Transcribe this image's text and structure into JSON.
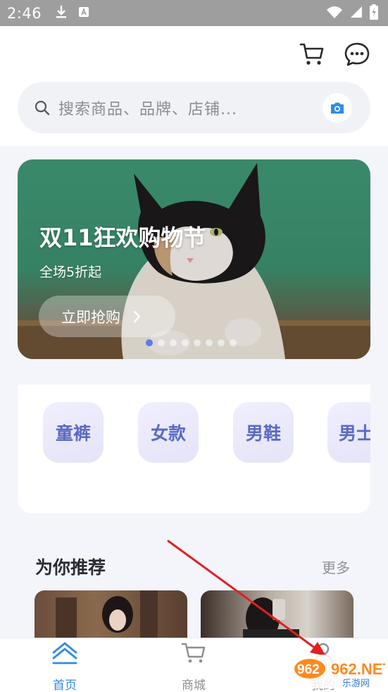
{
  "status_bar": {
    "time": "2:46",
    "icons": [
      "download-icon",
      "a-box-icon",
      "wifi-icon",
      "signal-icon",
      "battery-icon"
    ]
  },
  "header": {
    "cart_icon": "cart-icon",
    "message_icon": "message-icon"
  },
  "search": {
    "placeholder": "搜索商品、品牌、店铺...",
    "search_icon": "search-icon",
    "camera_icon": "camera-icon"
  },
  "banner": {
    "title": "双11狂欢购物节",
    "subtitle": "全场5折起",
    "cta_label": "立即抢购",
    "dot_count": 8,
    "active_dot": 0
  },
  "categories": [
    {
      "label": "童裤"
    },
    {
      "label": "女款"
    },
    {
      "label": "男鞋"
    },
    {
      "label": "男士"
    }
  ],
  "recommend": {
    "title": "为你推荐",
    "more_label": "更多"
  },
  "bottom_nav": {
    "items": [
      {
        "label": "首页",
        "icon": "home-icon",
        "active": true
      },
      {
        "label": "商城",
        "icon": "cart-icon",
        "active": false
      },
      {
        "label": "我的",
        "icon": "user-icon",
        "active": false
      }
    ]
  },
  "watermark": {
    "text": "962.NET",
    "subtext": "乐游网"
  },
  "colors": {
    "accent": "#2f8be6",
    "category_text": "#5a6ac4",
    "active_dot": "#5f7be8",
    "annotation_arrow": "#e02020"
  }
}
